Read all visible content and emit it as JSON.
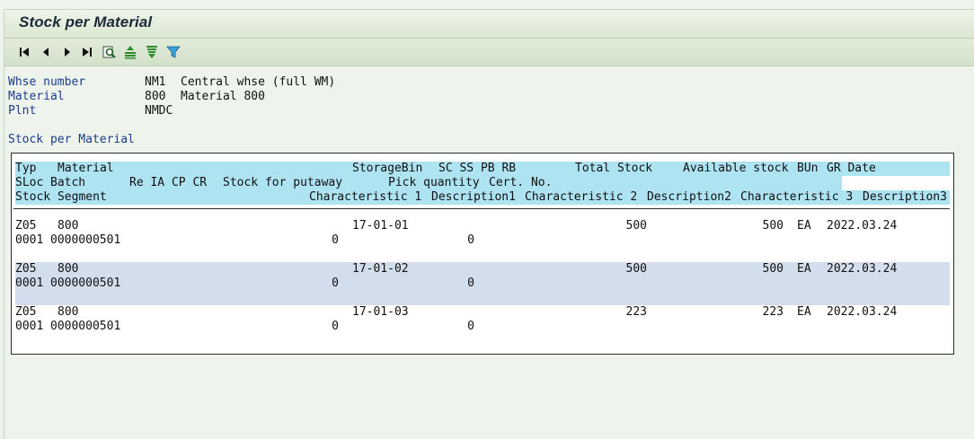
{
  "window": {
    "title": "Stock per Material"
  },
  "toolbar": {
    "buttons": [
      "first-page-icon",
      "previous-page-icon",
      "next-page-icon",
      "last-page-icon",
      "details-icon",
      "sort-ascending-icon",
      "sort-descending-icon",
      "filter-icon"
    ]
  },
  "info": {
    "whse_label": "Whse number",
    "whse_code": "NM1",
    "whse_desc": "Central whse (full WM)",
    "material_label": "Material",
    "material_code": "800",
    "material_desc": "Material 800",
    "plant_label": "Plnt",
    "plant_code": "NMDC"
  },
  "list": {
    "title": "Stock per Material",
    "header_line1": [
      "Typ",
      "Material",
      "StorageBin",
      "SC SS PB RB",
      "Total Stock",
      "Available stock",
      "BUn",
      "GR Date"
    ],
    "header_line2": [
      "SLoc",
      "Batch",
      "Re IA CP CR",
      "Stock for putaway",
      "Pick quantity",
      "Cert. No."
    ],
    "header_line3": [
      "Stock Segment",
      "Characteristic 1",
      "Description1",
      "Characteristic 2",
      "Description2",
      "Characteristic 3",
      "Description3"
    ],
    "rows": [
      {
        "typ": "Z05",
        "material": "800",
        "bin": "17-01-01",
        "total": "500",
        "avail": "500",
        "bun": "EA",
        "gr_date": "2022.03.24",
        "sloc": "0001",
        "batch": "0000000501",
        "putaway": "0",
        "pick": "0"
      },
      {
        "typ": "Z05",
        "material": "800",
        "bin": "17-01-02",
        "total": "500",
        "avail": "500",
        "bun": "EA",
        "gr_date": "2022.03.24",
        "sloc": "0001",
        "batch": "0000000501",
        "putaway": "0",
        "pick": "0"
      },
      {
        "typ": "Z05",
        "material": "800",
        "bin": "17-01-03",
        "total": "223",
        "avail": "223",
        "bun": "EA",
        "gr_date": "2022.03.24",
        "sloc": "0001",
        "batch": "0000000501",
        "putaway": "0",
        "pick": "0"
      }
    ]
  },
  "colors": {
    "label_blue": "#1a3e8c",
    "header_cyan": "#aee3f2",
    "row_blue": "#d3deec",
    "bg": "#eef3ec"
  }
}
